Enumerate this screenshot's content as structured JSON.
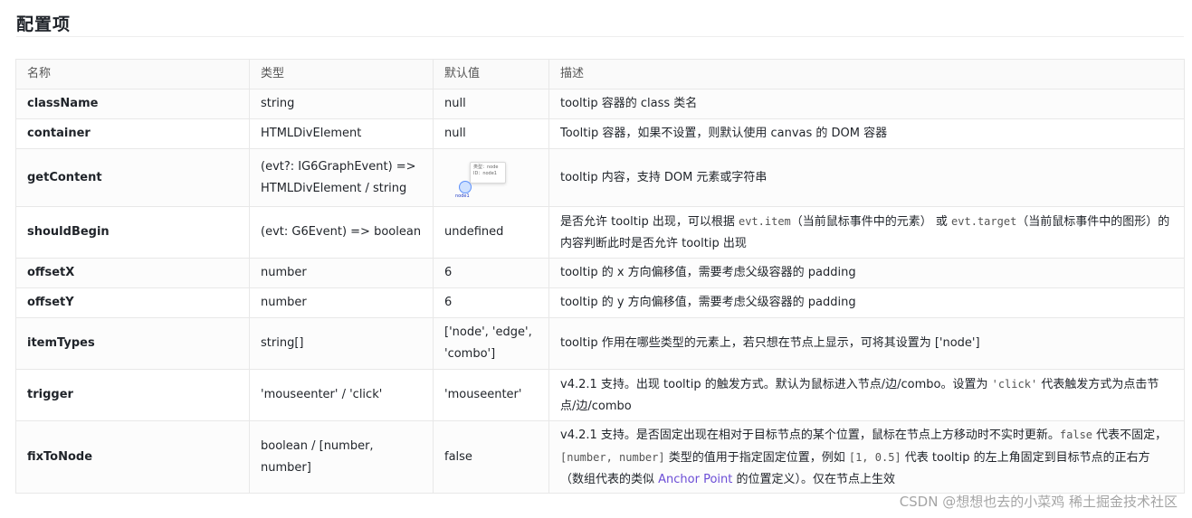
{
  "heading": "配置项",
  "columns": [
    "名称",
    "类型",
    "默认值",
    "描述"
  ],
  "rows": [
    {
      "name": "className",
      "type": "string",
      "default": "null",
      "desc": "tooltip 容器的 class 类名"
    },
    {
      "name": "container",
      "type": "HTMLDivElement",
      "default": "null",
      "desc": "Tooltip 容器，如果不设置，则默认使用 canvas 的 DOM 容器"
    },
    {
      "name": "getContent",
      "type": "(evt?: IG6GraphEvent) => HTMLDivElement / string",
      "default_image": {
        "title": "类型：node",
        "id": "ID：node1",
        "node_label": "node1"
      },
      "desc": "tooltip 内容，支持 DOM 元素或字符串"
    },
    {
      "name": "shouldBegin",
      "type": "(evt: G6Event) => boolean",
      "default": "undefined",
      "desc_parts": {
        "p1": "是否允许 tooltip 出现，可以根据 ",
        "c1": "evt.item",
        "p2": "（当前鼠标事件中的元素） 或 ",
        "c2": "evt.target",
        "p3": "（当前鼠标事件中的图形）的内容判断此时是否允许 tooltip 出现"
      }
    },
    {
      "name": "offsetX",
      "type": "number",
      "default": "6",
      "desc": "tooltip 的 x 方向偏移值，需要考虑父级容器的 padding"
    },
    {
      "name": "offsetY",
      "type": "number",
      "default": "6",
      "desc": "tooltip 的 y 方向偏移值，需要考虑父级容器的 padding"
    },
    {
      "name": "itemTypes",
      "type": "string[]",
      "default": "['node', 'edge', 'combo']",
      "desc": "tooltip 作用在哪些类型的元素上，若只想在节点上显示，可将其设置为 ['node']"
    },
    {
      "name": "trigger",
      "type": "'mouseenter' / 'click'",
      "default": "'mouseenter'",
      "desc_parts": {
        "p1": "v4.2.1 支持。出现 tooltip 的触发方式。默认为鼠标进入节点/边/combo。设置为 ",
        "c1": "'click'",
        "p2": " 代表触发方式为点击节点/边/combo"
      }
    },
    {
      "name": "fixToNode",
      "type": "boolean / [number, number]",
      "default": "false",
      "desc_parts": {
        "p1": "v4.2.1 支持。是否固定出现在相对于目标节点的某个位置，鼠标在节点上方移动时不实时更新。",
        "c1": "false",
        "p2": " 代表不固定，",
        "c2": "[number, number]",
        "p3": " 类型的值用于指定固定位置，例如 ",
        "c3": "[1, 0.5]",
        "p4": " 代表 tooltip 的左上角固定到目标节点的正右方（数组代表的类似 ",
        "link": "Anchor Point",
        "p5": " 的位置定义）。仅在节点上生效"
      }
    }
  ],
  "watermark": "CSDN @想想也去的小菜鸡 稀土掘金技术社区",
  "colors": {
    "link": "#6b4dd6",
    "border": "#e8e8e8",
    "header_bg": "#fafafa"
  }
}
